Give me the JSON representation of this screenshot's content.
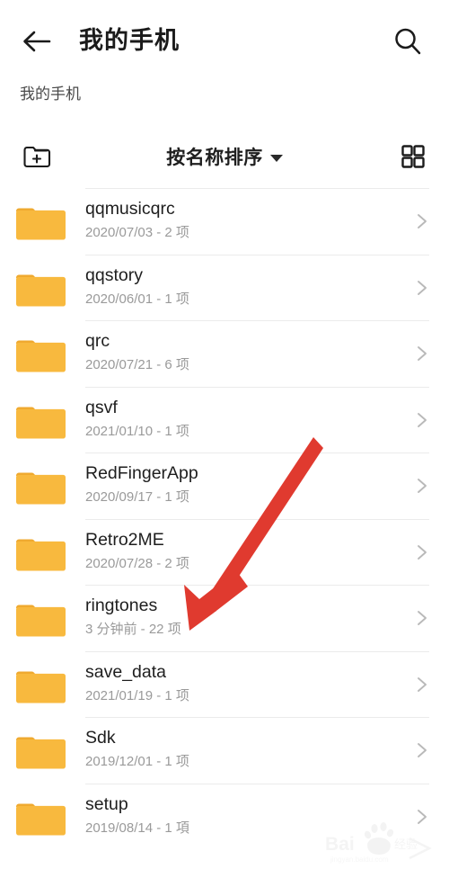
{
  "appbar": {
    "back_icon": "arrow-left-icon",
    "title": "我的手机",
    "search_icon": "search-icon"
  },
  "breadcrumb": {
    "path": "我的手机"
  },
  "toolbar": {
    "new_folder_icon": "new-folder-icon",
    "sort_label": "按名称排序",
    "sort_caret_icon": "chevron-down-icon",
    "grid_view_icon": "grid-view-icon"
  },
  "colors": {
    "folder": "#F8B93E",
    "folder_tab": "#EFA92F",
    "accent_arrow": "#E03A2F",
    "divider": "#EBEBEB",
    "text_primary": "#1E1E1E",
    "text_secondary": "#9A9A9A"
  },
  "list": {
    "chevron_icon": "chevron-right-icon",
    "folder_icon": "folder-icon",
    "items": [
      {
        "name": "qqmusicqrc",
        "meta": "2020/07/03 - 2 项"
      },
      {
        "name": "qqstory",
        "meta": "2020/06/01 - 1 项"
      },
      {
        "name": "qrc",
        "meta": "2020/07/21 - 6 项"
      },
      {
        "name": "qsvf",
        "meta": "2021/01/10 - 1 项"
      },
      {
        "name": "RedFingerApp",
        "meta": "2020/09/17 - 1 项"
      },
      {
        "name": "Retro2ME",
        "meta": "2020/07/28 - 2 项"
      },
      {
        "name": "ringtones",
        "meta": "3 分钟前 - 22 项"
      },
      {
        "name": "save_data",
        "meta": "2021/01/19 - 1 项"
      },
      {
        "name": "Sdk",
        "meta": "2019/12/01 - 1 项"
      },
      {
        "name": "setup",
        "meta": "2019/08/14 - 1 項"
      }
    ]
  },
  "annotation": {
    "arrow_icon": "red-arrow-annotation",
    "points_to": "ringtones"
  },
  "watermark": {
    "text": "Baidu 经验",
    "sub": "jingyan.baidu.com"
  }
}
